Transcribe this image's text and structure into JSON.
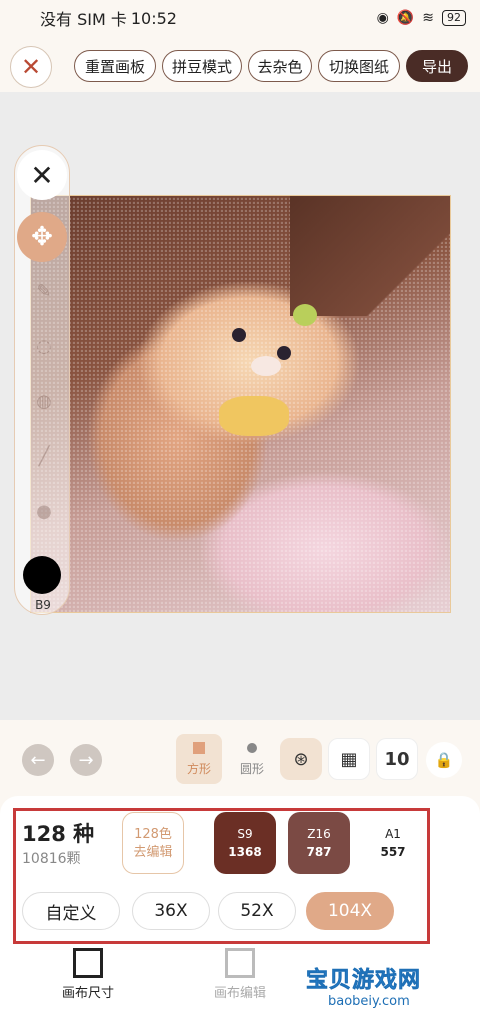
{
  "status_bar": {
    "carrier": "没有 SIM 卡",
    "time": "10:52",
    "battery": "92"
  },
  "toolbar": {
    "close_icon": "close-icon",
    "buttons": [
      "重置画板",
      "拼豆模式",
      "去杂色",
      "切换图纸"
    ],
    "export_label": "导出"
  },
  "tools": {
    "swatch_label": "B9",
    "swatch_color": "#000000"
  },
  "controls": {
    "shape_square_label": "方形",
    "shape_circle_label": "圆形",
    "value": "10"
  },
  "palette": {
    "count_label": "128 种",
    "beads_label": "10816颗",
    "edit_line1": "128色",
    "edit_line2": "去编辑",
    "colors": [
      {
        "code": "S9",
        "count": "1368",
        "bg": "#6b2f25",
        "fg": "#ffffff"
      },
      {
        "code": "Z16",
        "count": "787",
        "bg": "#7b4a44",
        "fg": "#ffffff"
      },
      {
        "code": "A1",
        "count": "557",
        "bg": "#ffffff",
        "fg": "#222222"
      }
    ],
    "sizes": [
      "自定义",
      "36X",
      "52X",
      "104X"
    ],
    "selected_size": "104X"
  },
  "nav": {
    "items": [
      "画布尺寸",
      "画布编辑"
    ]
  },
  "watermark": {
    "title": "宝贝游戏网",
    "site": "baobeiy.com"
  }
}
